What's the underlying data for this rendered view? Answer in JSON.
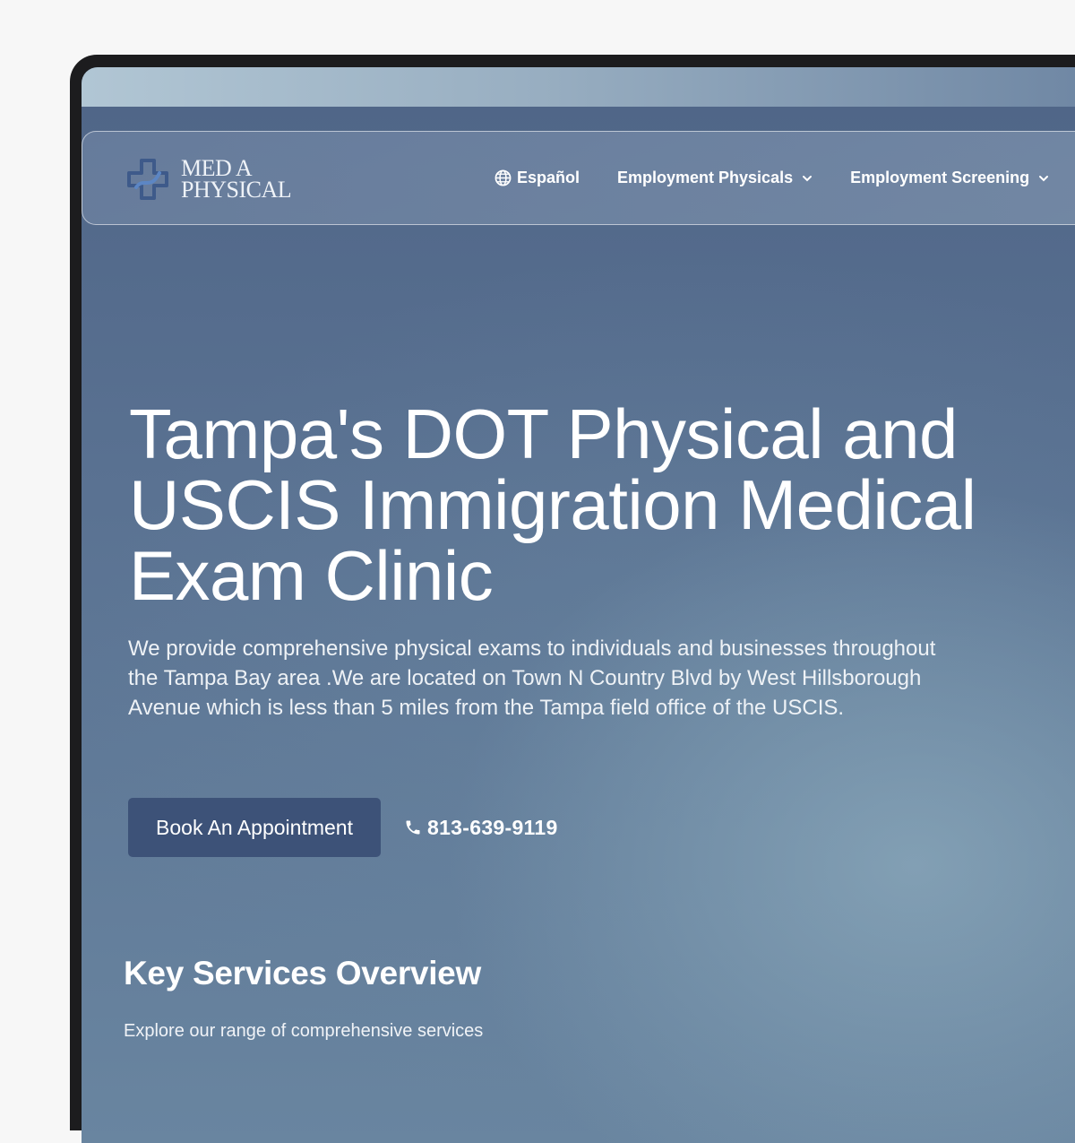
{
  "brand": {
    "logo_line1": "MED A",
    "logo_line2": "PHYSICAL",
    "logo_icon": "medical-cross-icon"
  },
  "nav": {
    "language": {
      "label": "Español",
      "icon": "globe-icon"
    },
    "items": [
      {
        "label": "Employment Physicals",
        "icon": "chevron-down-icon"
      },
      {
        "label": "Employment Screening",
        "icon": "chevron-down-icon"
      }
    ]
  },
  "hero": {
    "title": "Tampa's DOT Physical and USCIS Immigration Medical Exam Clinic",
    "description": "We provide comprehensive physical exams to individuals and businesses throughout the Tampa Bay area .We are located on Town N Country Blvd by West Hillsborough Avenue which is less than 5 miles from the Tampa field office of the USCIS.",
    "book_button": "Book An Appointment",
    "phone": "813-639-9119",
    "phone_icon": "phone-icon"
  },
  "services": {
    "title": "Key Services Overview",
    "subtitle": "Explore our range of comprehensive services"
  },
  "colors": {
    "button_bg": "#3d5278",
    "hero_bg_top": "#4f6587",
    "hero_bg_glow": "#8caabc"
  }
}
